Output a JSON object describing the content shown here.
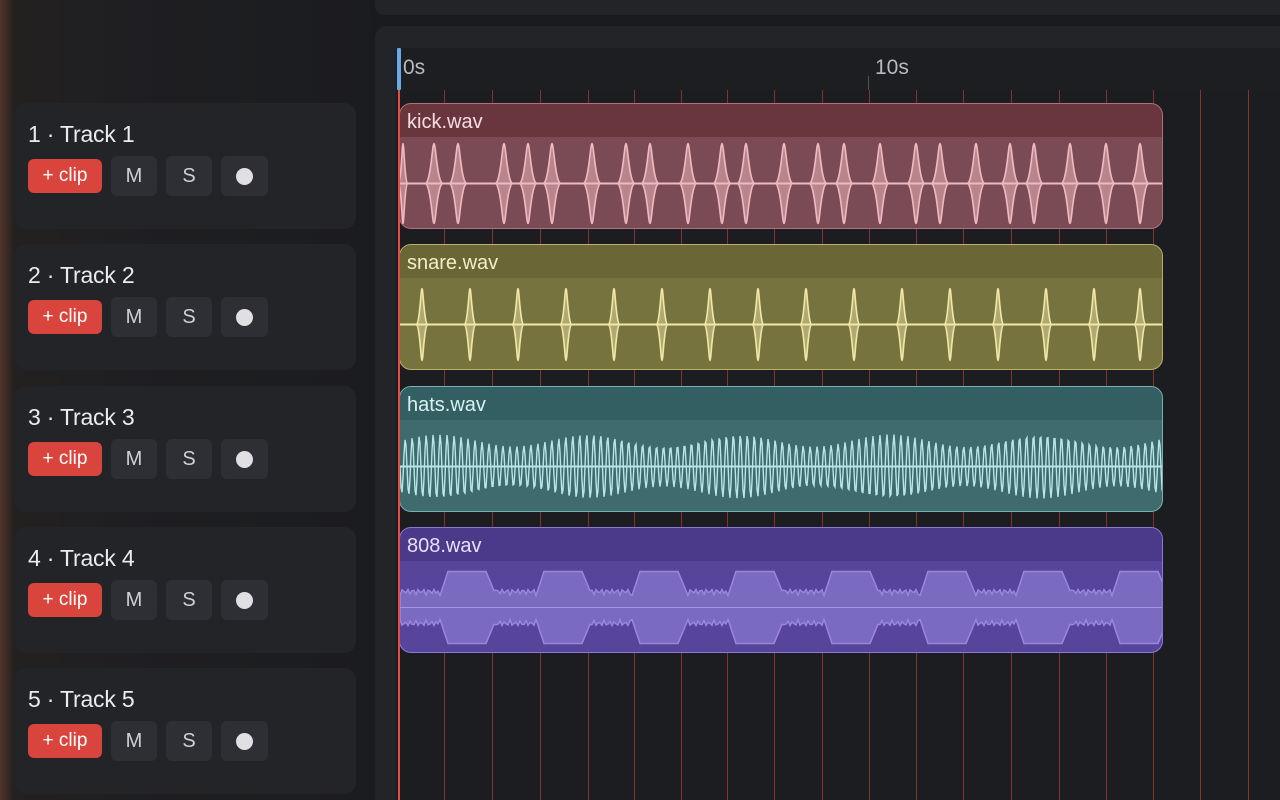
{
  "tracks": [
    {
      "title": "1 · Track 1",
      "clip_button": "+ clip",
      "mute": "M",
      "solo": "S"
    },
    {
      "title": "2 · Track 2",
      "clip_button": "+ clip",
      "mute": "M",
      "solo": "S"
    },
    {
      "title": "3 · Track 3",
      "clip_button": "+ clip",
      "mute": "M",
      "solo": "S"
    },
    {
      "title": "4 · Track 4",
      "clip_button": "+ clip",
      "mute": "M",
      "solo": "S"
    },
    {
      "title": "5 · Track 5",
      "clip_button": "+ clip",
      "mute": "M",
      "solo": "S"
    }
  ],
  "ruler": {
    "labels": [
      "0s",
      "10s"
    ]
  },
  "clips": [
    {
      "name": "kick.wav",
      "color_body": "#7a4a55",
      "color_head": "#6a363e",
      "color_border": "#b0707c",
      "color_wave": "#efb9c0",
      "color_text": "#f4dde0"
    },
    {
      "name": "snare.wav",
      "color_body": "#76733f",
      "color_head": "#6a6636",
      "color_border": "#b6b06a",
      "color_wave": "#f0e8a8",
      "color_text": "#f3eec8"
    },
    {
      "name": "hats.wav",
      "color_body": "#3f6a6e",
      "color_head": "#335f62",
      "color_border": "#76b1b5",
      "color_wave": "#b8e6e8",
      "color_text": "#d8f1f2"
    },
    {
      "name": "808.wav",
      "color_body": "#56459a",
      "color_head": "#4b3a8a",
      "color_border": "#8b78d6",
      "color_wave": "#9a86e0",
      "color_text": "#e6e0fa"
    }
  ]
}
